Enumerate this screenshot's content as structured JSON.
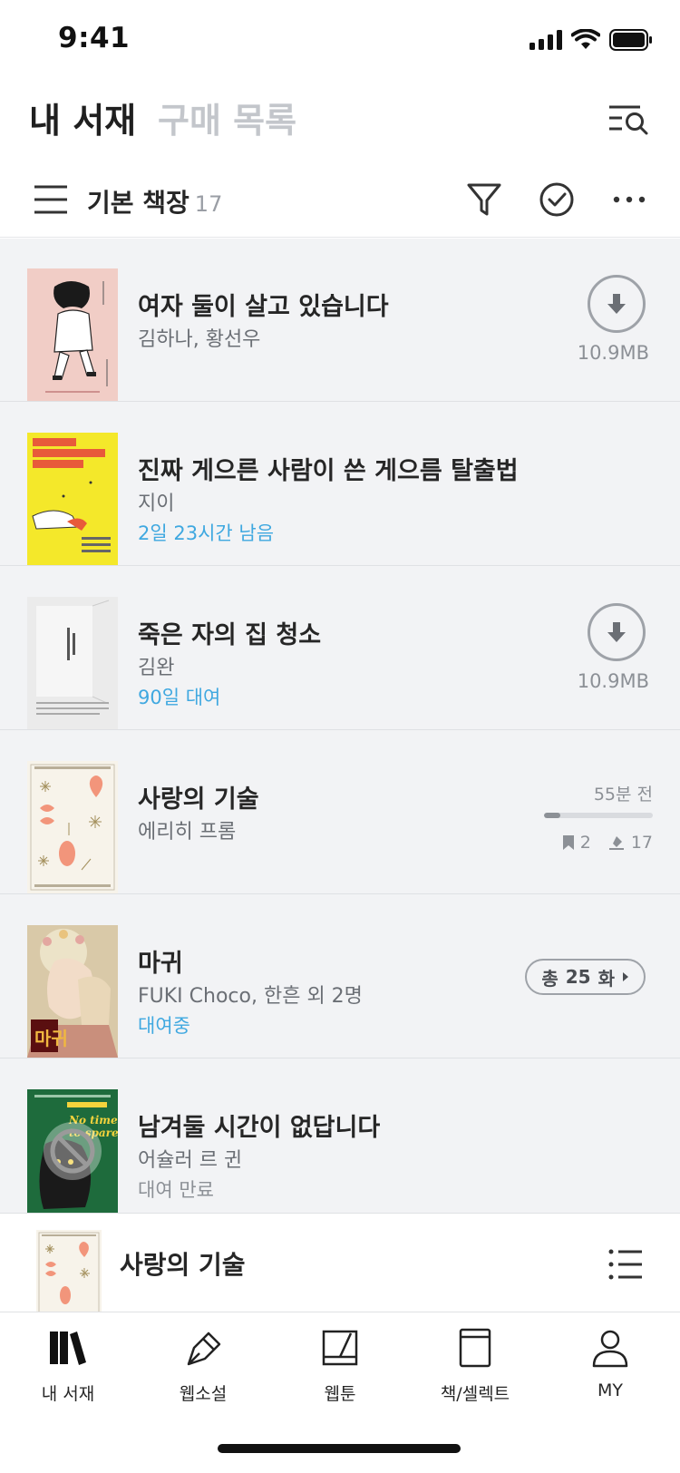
{
  "status_bar": {
    "time": "9:41"
  },
  "header": {
    "tabs": [
      {
        "label": "내 서재",
        "active": true
      },
      {
        "label": "구매 목록",
        "active": false
      }
    ]
  },
  "toolbar": {
    "shelf_name": "기본 책장",
    "shelf_count": "17"
  },
  "books": [
    {
      "title": "여자 둘이 살고 있습니다",
      "author": "김하나, 황선우",
      "status": "",
      "file_size": "10.9MB",
      "cover_color": "#f1cdc6"
    },
    {
      "title": "진짜 게으른 사람이 쓴 게으름 탈출법",
      "author": "지이",
      "status": "2일 23시간 남음",
      "cover_color": "#f4e82a"
    },
    {
      "title": "죽은 자의 집 청소",
      "author": "김완",
      "status": "90일 대여",
      "file_size": "10.9MB",
      "cover_color": "#ebebeb"
    },
    {
      "title": "사랑의 기술",
      "author": "에리히 프롬",
      "last_read": "55분 전",
      "progress": 0.15,
      "bookmarks": "2",
      "highlights": "17",
      "cover_color": "#f7f3ea"
    },
    {
      "title": "마귀",
      "author": "FUKI Choco, 한흔 외 2명",
      "status": "대여중",
      "episodes_prefix": "총",
      "episodes": "25",
      "episodes_suffix": "화",
      "cover_color": "#d9c9a8"
    },
    {
      "title": "남겨둘 시간이 없답니다",
      "author": "어슐러 르 귄",
      "status": "대여 만료",
      "cover_color": "#1e6b3c"
    }
  ],
  "mini_player": {
    "title": "사랑의 기술"
  },
  "nav": [
    {
      "label": "내 서재",
      "icon": "library-icon"
    },
    {
      "label": "웹소설",
      "icon": "pen-icon"
    },
    {
      "label": "웹툰",
      "icon": "webtoon-icon"
    },
    {
      "label": "책/셀렉트",
      "icon": "book-icon"
    },
    {
      "label": "MY",
      "icon": "profile-icon"
    }
  ],
  "colors": {
    "accent_blue": "#3fa8e0",
    "list_bg": "#f2f3f5",
    "muted_gray": "#8c9096"
  }
}
